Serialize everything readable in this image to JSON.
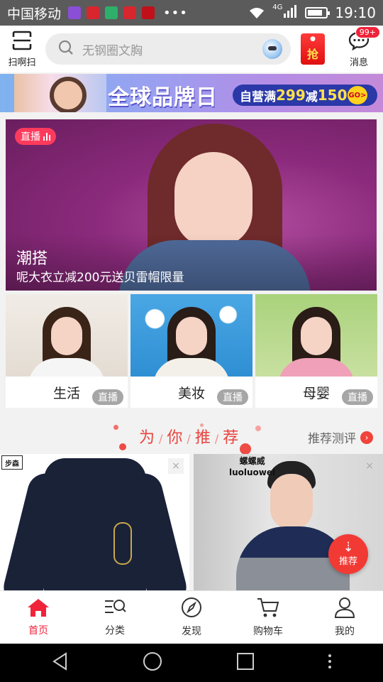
{
  "status_bar": {
    "carrier": "中国移动",
    "network": "4G",
    "time": "19:10"
  },
  "header": {
    "scan_label": "扫啊扫",
    "search_placeholder": "无钢圈文胸",
    "grab_label": "抢",
    "messages_label": "消息",
    "messages_badge": "99+"
  },
  "promo_banner": {
    "title": "全球品牌日",
    "offer_prefix": "自营满",
    "offer_amount": "299",
    "offer_mid": "减",
    "offer_discount": "150",
    "go_label": "GO>"
  },
  "live_hero": {
    "live_tag": "直播",
    "title": "潮搭",
    "subtitle": "呢大衣立减200元送贝雷帽限量"
  },
  "categories": [
    {
      "label": "生活",
      "badge": "直播"
    },
    {
      "label": "美妆",
      "badge": "直播"
    },
    {
      "label": "母婴",
      "badge": "直播"
    }
  ],
  "recommend": {
    "title_chars": [
      "为",
      "你",
      "推",
      "荐"
    ],
    "evaluation_label": "推荐测评",
    "arrow": "›"
  },
  "products": {
    "left_brand": "步森",
    "right_brand_cn": "螺螺威",
    "right_brand_en": "luoluowei",
    "close_icon": "×"
  },
  "floating_button": {
    "label": "推荐"
  },
  "tabs": [
    {
      "label": "首页",
      "active": true
    },
    {
      "label": "分类",
      "active": false
    },
    {
      "label": "发现",
      "active": false
    },
    {
      "label": "购物车",
      "active": false
    },
    {
      "label": "我的",
      "active": false
    }
  ],
  "colors": {
    "accent": "#f0233a",
    "status_bar": "#5b5b5b",
    "live_tag": "#ff3a5c",
    "recommend_title": "#e8433e"
  }
}
